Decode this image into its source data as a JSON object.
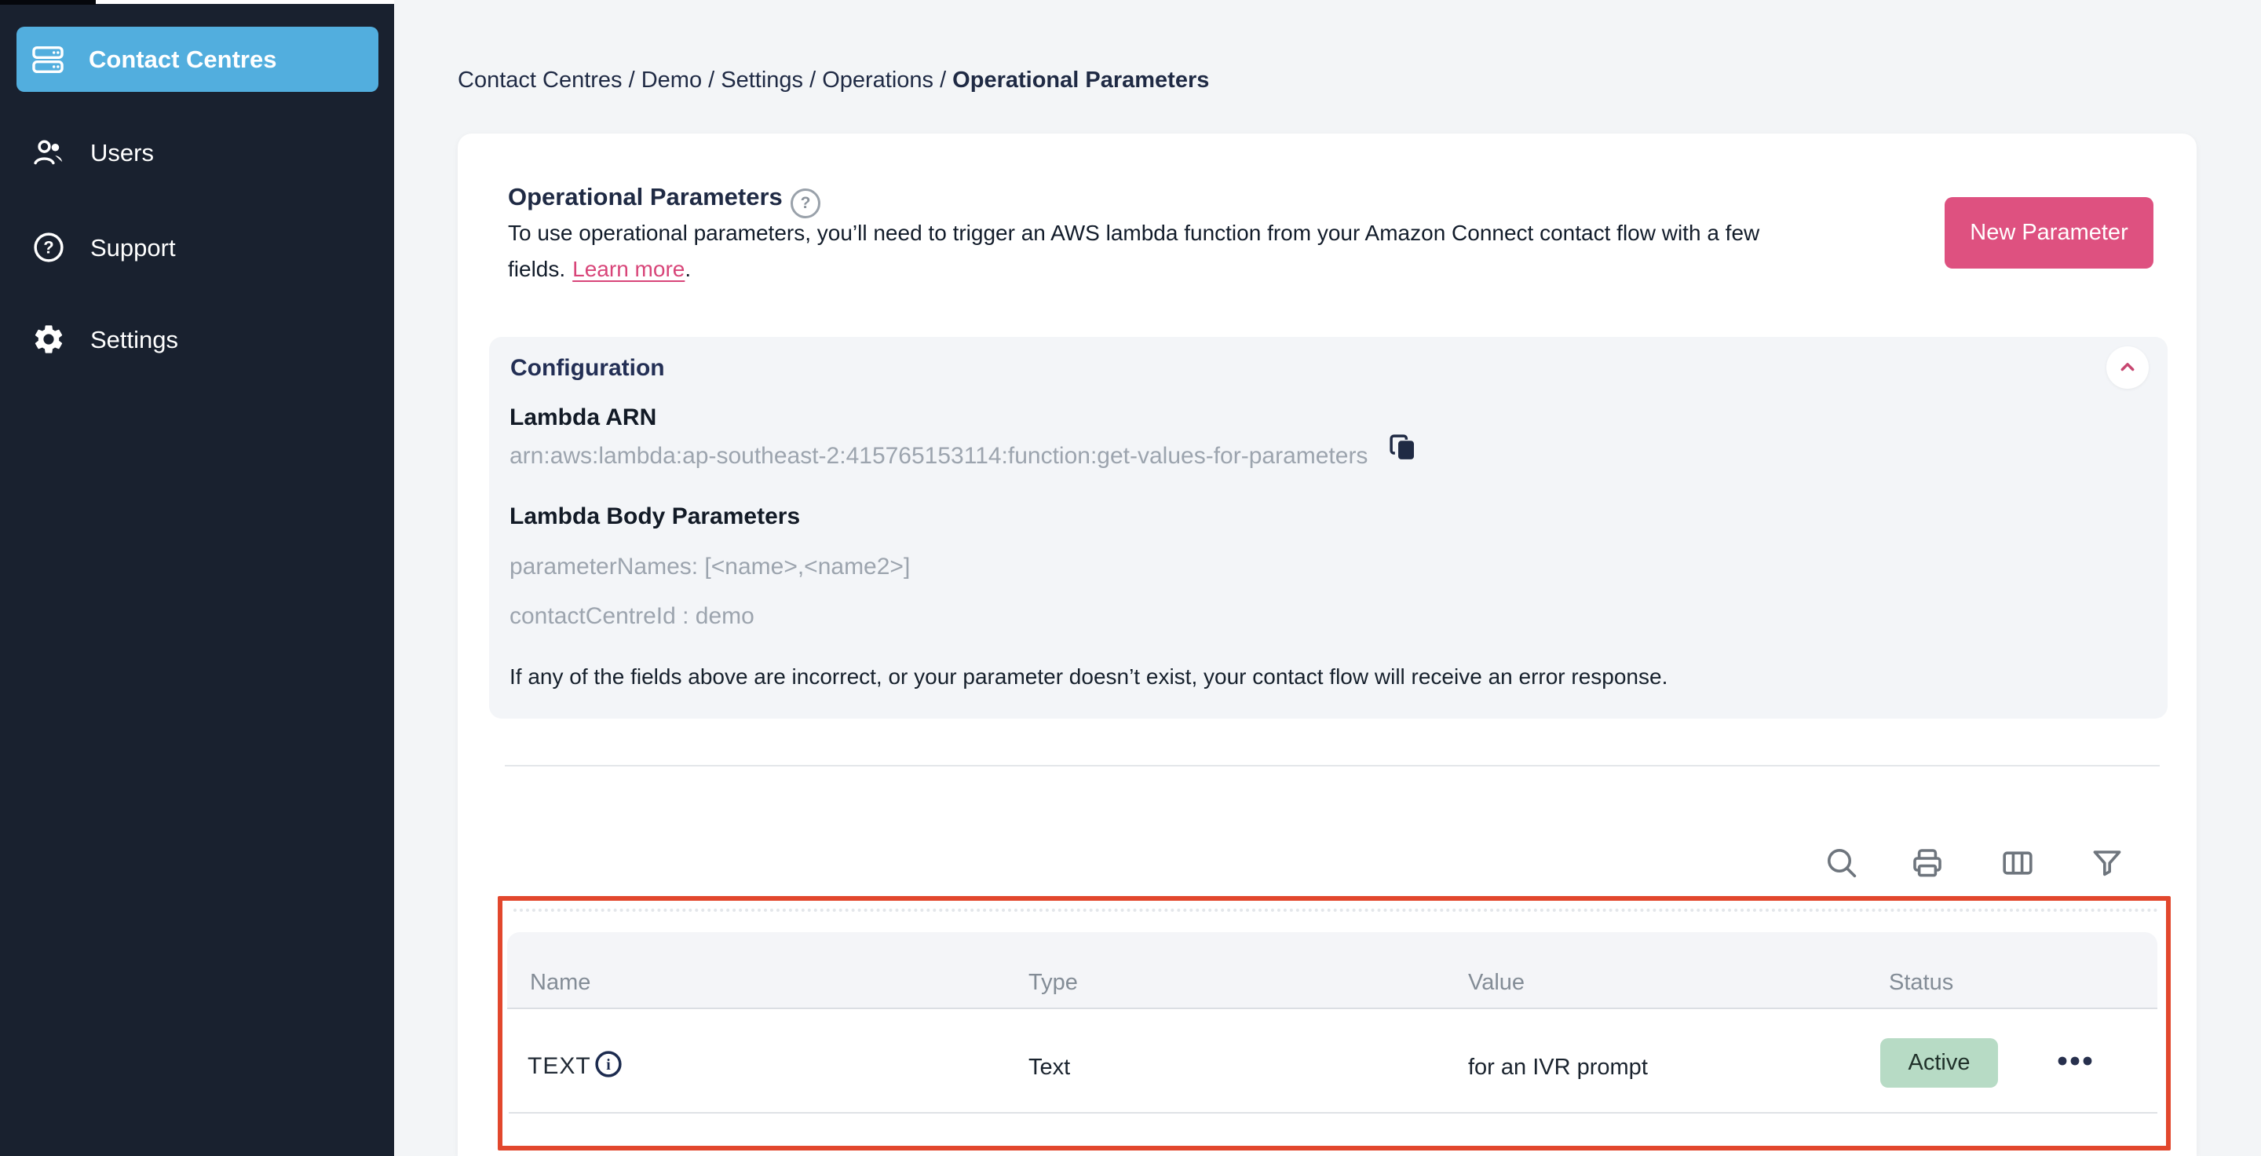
{
  "sidebar": {
    "items": [
      {
        "label": "Contact Centres",
        "active": true
      },
      {
        "label": "Users",
        "active": false
      },
      {
        "label": "Support",
        "active": false
      },
      {
        "label": "Settings",
        "active": false
      }
    ]
  },
  "breadcrumb": {
    "path_prefix": "Contact Centres / Demo / Settings / Operations /",
    "current": "Operational Parameters"
  },
  "header": {
    "title": "Operational Parameters",
    "description_line1": "To use operational parameters, you’ll need to trigger an AWS lambda function from your Amazon Connect contact flow with a few",
    "description_line2_prefix": "fields.",
    "learn_more_label": "Learn more",
    "period": ".",
    "new_parameter_label": "New Parameter"
  },
  "configuration": {
    "title": "Configuration",
    "lambda_arn_label": "Lambda ARN",
    "lambda_arn_value": "arn:aws:lambda:ap-southeast-2:415765153114:function:get-values-for-parameters",
    "lambda_body_label": "Lambda Body Parameters",
    "parameter_names": "parameterNames: [<name>,<name2>]",
    "contact_centre_id": "contactCentreId : demo",
    "note": "If any of the fields above are incorrect, or your parameter doesn’t exist, your contact flow will receive an error response."
  },
  "table": {
    "columns": [
      "Name",
      "Type",
      "Value",
      "Status"
    ],
    "rows": [
      {
        "name": "TEXT",
        "type": "Text",
        "value": "for an IVR prompt",
        "status": "Active"
      }
    ]
  },
  "icons": {
    "help_glyph": "?",
    "support_glyph": "?",
    "info_glyph": "i",
    "toolbar": [
      "search",
      "print",
      "view-columns",
      "filter"
    ]
  },
  "colors": {
    "sidebar_bg": "#19212F",
    "sidebar_active": "#52AEDE",
    "accent_pink": "#DE5180",
    "link_pink": "#D84579",
    "chevron_pink": "#C74670",
    "highlight_red": "#E2472D",
    "badge_green_bg": "#B7DBC5",
    "navy_text": "#1F2A44"
  }
}
